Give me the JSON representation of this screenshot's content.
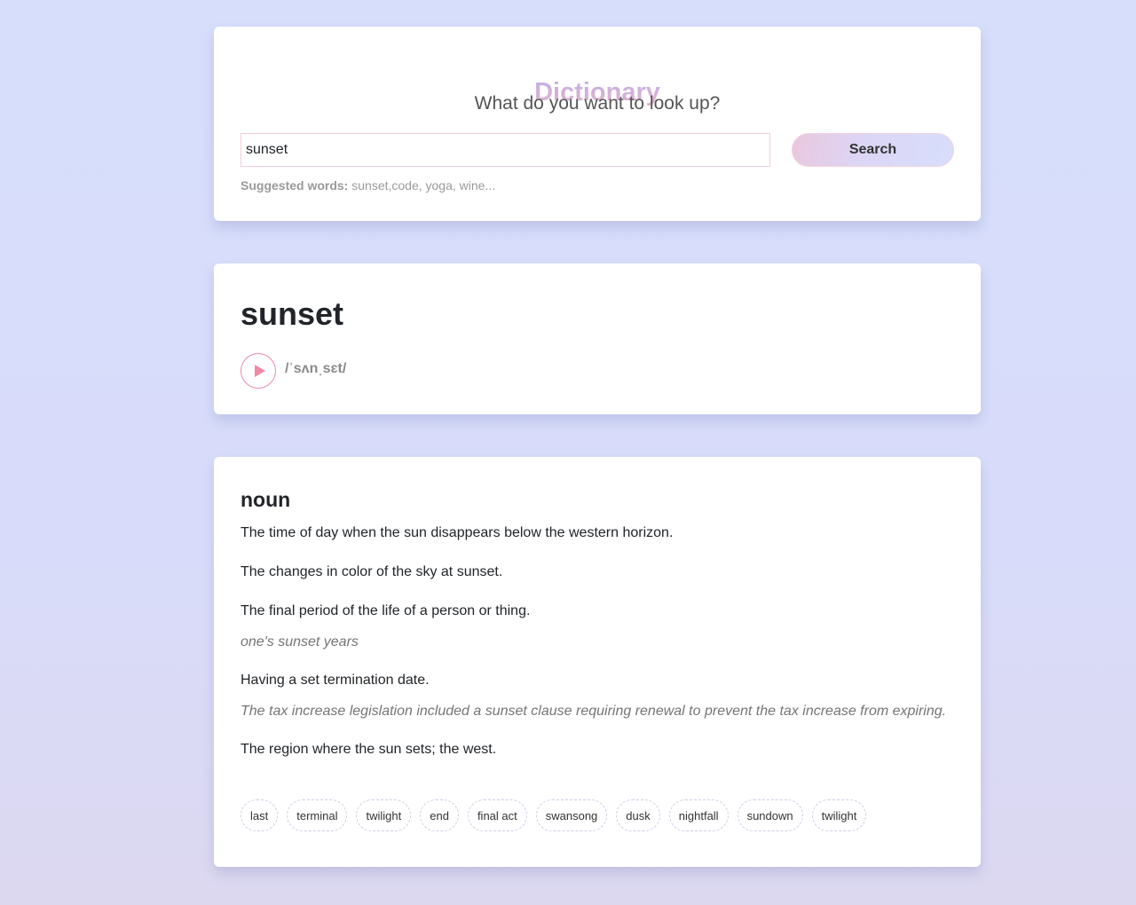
{
  "header": {
    "title": "Dictionary",
    "subtitle": "What do you want to look up?"
  },
  "search": {
    "value": "sunset",
    "button_label": "Search",
    "suggestions_label": "Suggested words:",
    "suggestions_text": "sunset,code, yoga, wine..."
  },
  "result": {
    "word": "sunset",
    "phonetic": "/ˈsʌnˌsɛt/",
    "play_icon": "play-icon"
  },
  "meaning": {
    "part_of_speech": "noun",
    "definitions": [
      {
        "text": "The time of day when the sun disappears below the western horizon.",
        "example": null
      },
      {
        "text": "The changes in color of the sky at sunset.",
        "example": null
      },
      {
        "text": "The final period of the life of a person or thing.",
        "example": "one's sunset years"
      },
      {
        "text": "Having a set termination date.",
        "example": "The tax increase legislation included a sunset clause requiring renewal to prevent the tax increase from expiring."
      },
      {
        "text": "The region where the sun sets; the west.",
        "example": null
      }
    ],
    "synonyms": [
      "last",
      "terminal",
      "twilight",
      "end",
      "final act",
      "swansong",
      "dusk",
      "nightfall",
      "sundown",
      "twilight"
    ]
  },
  "colors": {
    "accent_pink": "#f08aa4",
    "background_top": "#d6defb",
    "background_bottom": "#dcd8f0"
  }
}
